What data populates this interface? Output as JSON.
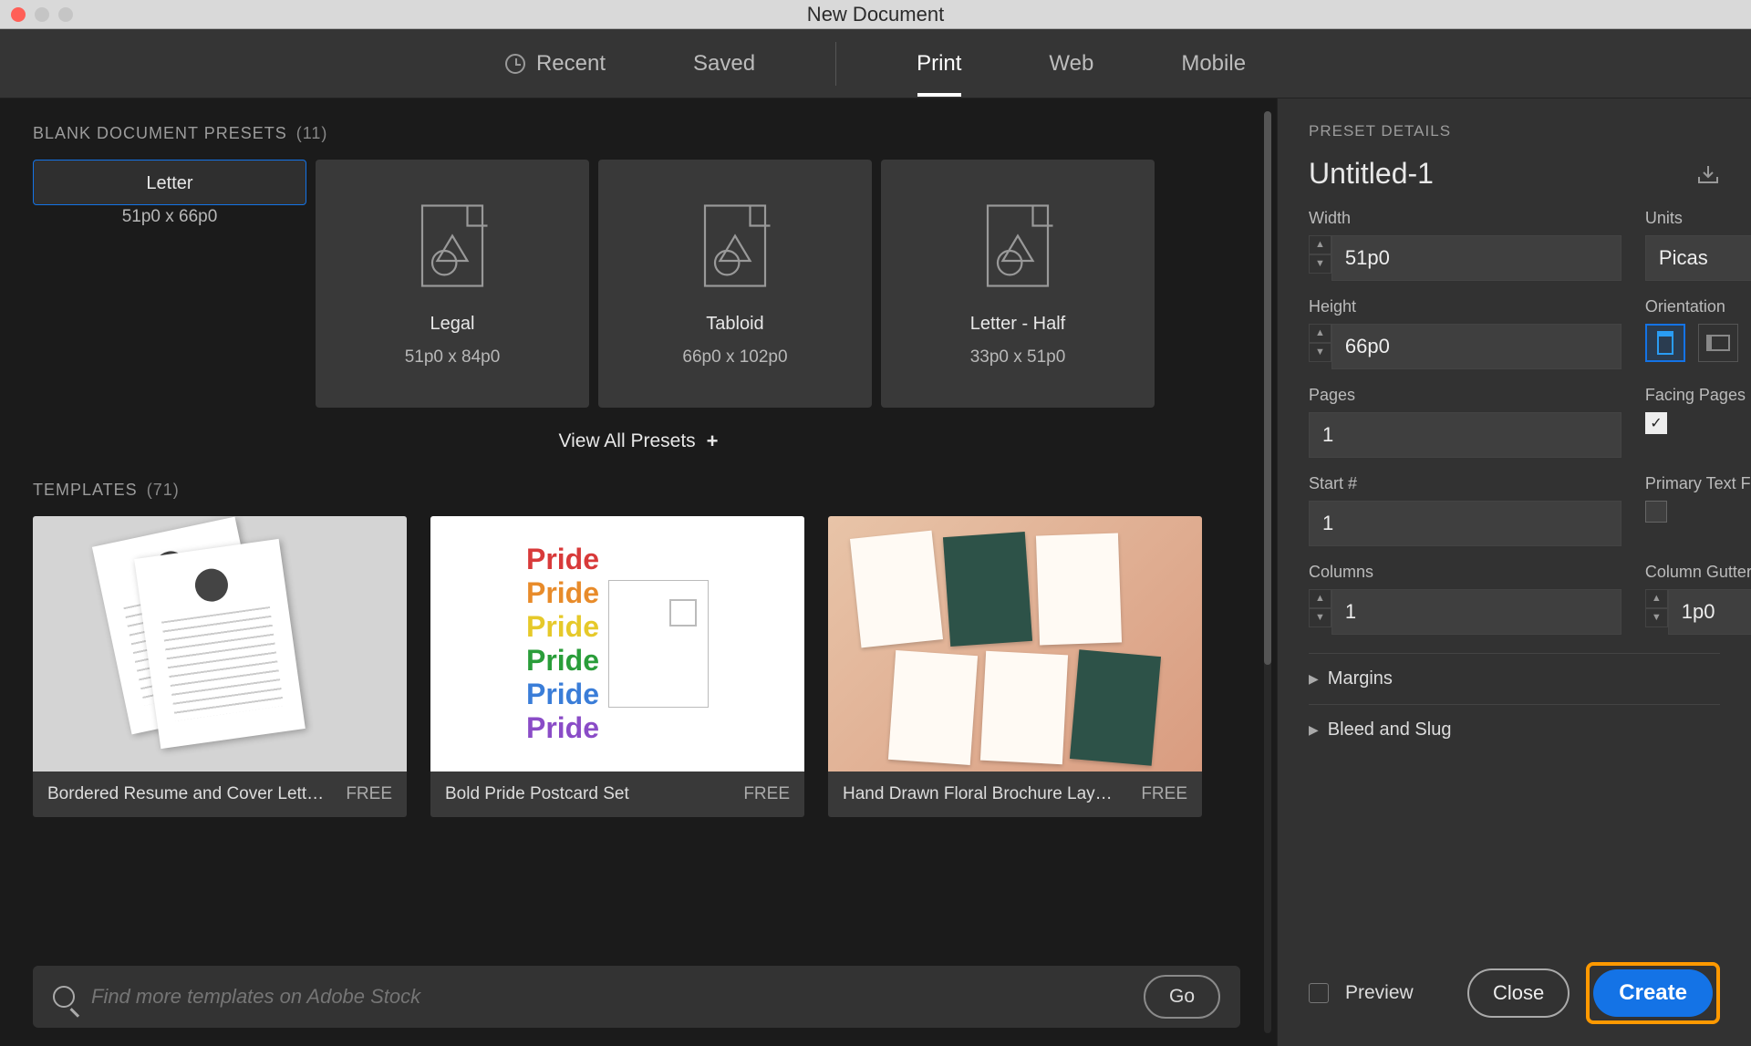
{
  "window": {
    "title": "New Document"
  },
  "nav": {
    "recent": "Recent",
    "saved": "Saved",
    "print": "Print",
    "web": "Web",
    "mobile": "Mobile"
  },
  "presets_header": {
    "label": "BLANK DOCUMENT PRESETS",
    "count": "(11)"
  },
  "presets": [
    {
      "name": "Letter",
      "dim": "51p0 x 66p0"
    },
    {
      "name": "Legal",
      "dim": "51p0 x 84p0"
    },
    {
      "name": "Tabloid",
      "dim": "66p0 x 102p0"
    },
    {
      "name": "Letter - Half",
      "dim": "33p0 x 51p0"
    }
  ],
  "view_all": "View All Presets",
  "templates_header": {
    "label": "TEMPLATES",
    "count": "(71)"
  },
  "templates": [
    {
      "name": "Bordered Resume and Cover Lett…",
      "price": "FREE"
    },
    {
      "name": "Bold Pride Postcard Set",
      "price": "FREE"
    },
    {
      "name": "Hand Drawn Floral Brochure Lay…",
      "price": "FREE"
    }
  ],
  "search": {
    "placeholder": "Find more templates on Adobe Stock",
    "go": "Go"
  },
  "details": {
    "header": "PRESET DETAILS",
    "name": "Untitled-1",
    "width_label": "Width",
    "width": "51p0",
    "units_label": "Units",
    "units": "Picas",
    "height_label": "Height",
    "height": "66p0",
    "orientation_label": "Orientation",
    "pages_label": "Pages",
    "pages": "1",
    "facing_label": "Facing Pages",
    "start_label": "Start #",
    "start": "1",
    "primary_label": "Primary Text Frame",
    "columns_label": "Columns",
    "columns": "1",
    "gutter_label": "Column Gutter",
    "gutter": "1p0",
    "margins": "Margins",
    "bleed": "Bleed and Slug"
  },
  "footer": {
    "preview": "Preview",
    "close": "Close",
    "create": "Create"
  }
}
